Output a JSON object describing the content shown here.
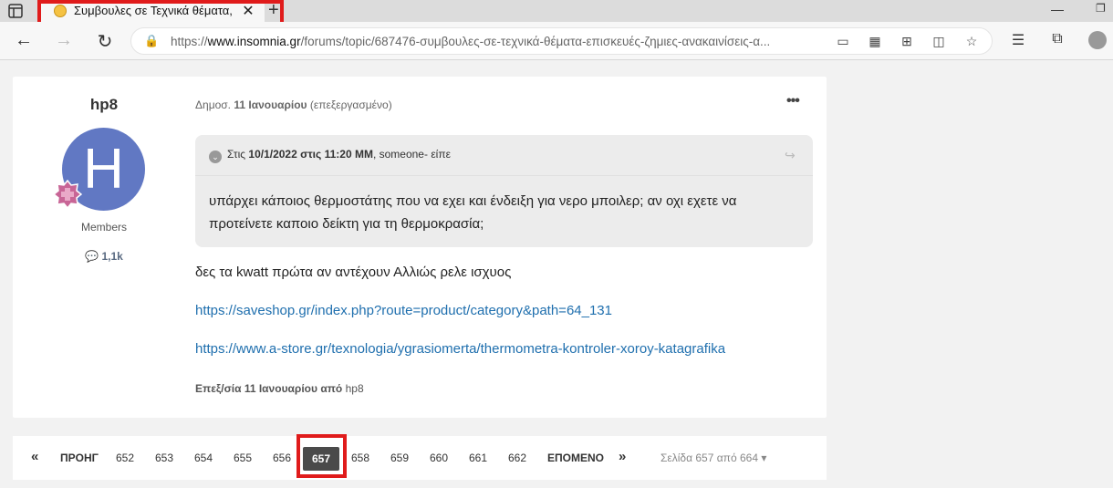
{
  "browser": {
    "tab_title": "Συμβουλες σε Τεχνικά θέματα, επ",
    "url_prefix": "https://",
    "url_domain": "www.insomnia.gr",
    "url_path": "/forums/topic/687476-συμβουλες-σε-τεχνικά-θέματα-επισκευές-ζημιες-ανακαινίσεις-α..."
  },
  "post": {
    "author_name": "hp8",
    "avatar_letter": "H",
    "author_group": "Members",
    "author_post_count": "1,1k",
    "posted_label": "Δημοσ.",
    "posted_date": "11 Ιανουαρίου",
    "posted_suffix": "(επεξεργασμένο)",
    "quote": {
      "header_prefix": "Στις",
      "header_date": "10/1/2022 στις 11:20 ΜΜ",
      "header_user": "someone-",
      "header_suffix": "είπε",
      "text": "υπάρχει κάποιος θερμοστάτης που να εχει και ένδειξη για νερο μποιλερ; αν οχι εχετε να προτείνετε καποιο δείκτη για τη θερμοκρασία;"
    },
    "body_text": "δες τα kwatt  πρώτα αν αντέχουν Αλλιώς ρελε ισχυος",
    "links": [
      "https://saveshop.gr/index.php?route=product/category&path=64_131",
      "https://www.a-store.gr/texnologia/ygrasiomerta/thermometra-kontroler-xoroy-katagrafika"
    ],
    "edited_prefix": "Επεξ/σία",
    "edited_date": "11 Ιανουαρίου",
    "edited_by": "από",
    "edited_user": "hp8"
  },
  "pagination": {
    "first": "«",
    "prev": "ΠΡΟΗΓ",
    "pages_before": [
      "652",
      "653",
      "654",
      "655",
      "656"
    ],
    "current": "657",
    "pages_after": [
      "658",
      "659",
      "660",
      "661",
      "662"
    ],
    "next": "ΕΠΟΜΕΝΟ",
    "last": "»",
    "page_jump": "Σελίδα 657 από 664"
  },
  "colors": {
    "highlight": "#e01b1b",
    "link": "#1f6fae",
    "avatar": "#6178c3"
  }
}
